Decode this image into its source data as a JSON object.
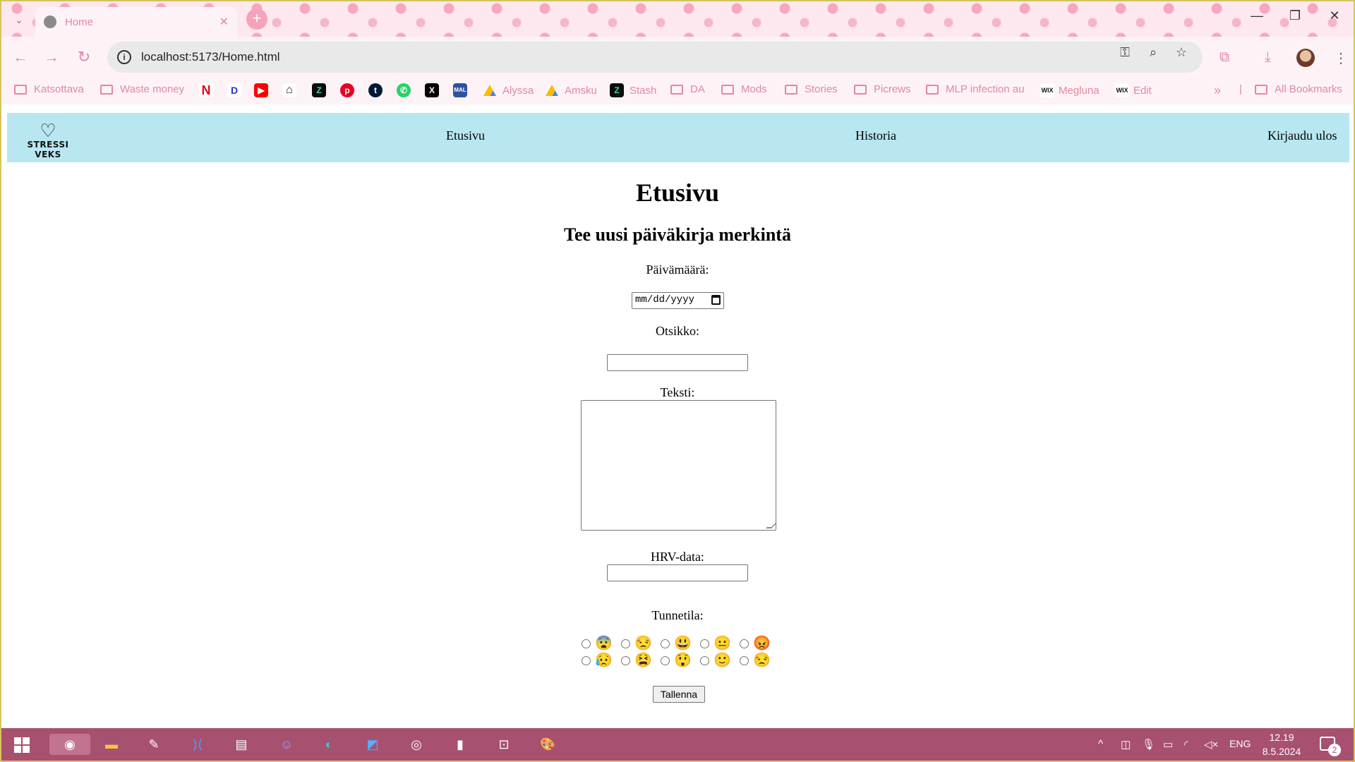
{
  "browser": {
    "tab_title": "Home",
    "url": "localhost:5173/Home.html",
    "bookmarks": [
      {
        "label": "Katsottava",
        "type": "folder"
      },
      {
        "label": "Waste money",
        "type": "folder"
      },
      {
        "label": "",
        "type": "netflix-icon"
      },
      {
        "label": "",
        "type": "disney-plus-icon"
      },
      {
        "label": "",
        "type": "youtube-icon"
      },
      {
        "label": "",
        "type": "house-icon"
      },
      {
        "label": "",
        "type": "stash-icon"
      },
      {
        "label": "",
        "type": "pinterest-icon"
      },
      {
        "label": "",
        "type": "tumblr-icon"
      },
      {
        "label": "",
        "type": "whatsapp-icon"
      },
      {
        "label": "",
        "type": "x-icon"
      },
      {
        "label": "",
        "type": "mal-icon"
      },
      {
        "label": "Alyssa",
        "type": "drive-icon"
      },
      {
        "label": "Amsku",
        "type": "drive-icon"
      },
      {
        "label": "Stash",
        "type": "stash-icon"
      },
      {
        "label": "DA",
        "type": "folder"
      },
      {
        "label": "Mods",
        "type": "folder"
      },
      {
        "label": "Stories",
        "type": "folder"
      },
      {
        "label": "Picrews",
        "type": "folder"
      },
      {
        "label": "MLP infection au",
        "type": "folder"
      },
      {
        "label": "Megluna",
        "type": "wix-icon"
      },
      {
        "label": "Edit",
        "type": "wix-icon"
      }
    ],
    "all_bookmarks": "All Bookmarks"
  },
  "site": {
    "logo_text": "STRESSI VEKS",
    "nav": {
      "home": "Etusivu",
      "history": "Historia",
      "logout": "Kirjaudu ulos"
    }
  },
  "page": {
    "title": "Etusivu",
    "subtitle": "Tee uusi päiväkirja merkintä",
    "date_label": "Päivämäärä:",
    "date_placeholder": "mm/dd/yyyy",
    "title_label": "Otsikko:",
    "text_label": "Teksti:",
    "hrv_label": "HRV-data:",
    "mood_label": "Tunnetila:",
    "moods_row1": [
      "😨",
      "😒",
      "😃",
      "😐",
      "😡"
    ],
    "moods_row2": [
      "😥",
      "😫",
      "😲",
      "🙂",
      "😒"
    ],
    "submit": "Tallenna"
  },
  "taskbar": {
    "time": "12.19",
    "date": "8.5.2024",
    "lang": "ENG",
    "notifications": "2"
  }
}
